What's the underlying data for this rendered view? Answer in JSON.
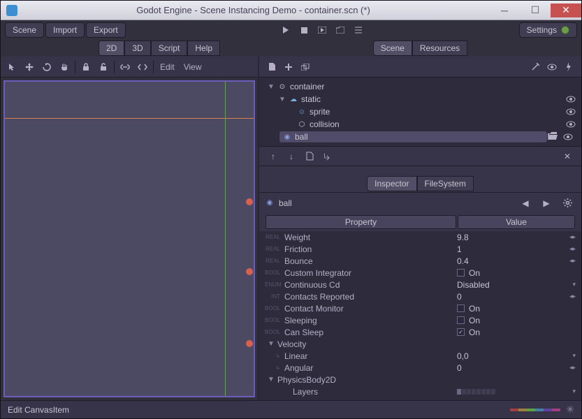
{
  "window": {
    "title": "Godot Engine - Scene Instancing Demo - container.scn (*)"
  },
  "menubar": {
    "scene": "Scene",
    "import": "Import",
    "export": "Export",
    "settings": "Settings"
  },
  "mode_tabs": {
    "d2": "2D",
    "d3": "3D",
    "script": "Script",
    "help": "Help"
  },
  "right_tabs": {
    "scene": "Scene",
    "resources": "Resources"
  },
  "viewport_toolbar": {
    "edit": "Edit",
    "view": "View"
  },
  "scene_tree": {
    "root": "container",
    "children": [
      {
        "name": "static",
        "icon": "cloud"
      },
      {
        "name": "sprite",
        "icon": "smiley",
        "indent": 1
      },
      {
        "name": "collision",
        "icon": "poly",
        "indent": 1
      },
      {
        "name": "ball",
        "icon": "ball",
        "selected": true
      }
    ]
  },
  "inspector_tabs": {
    "inspector": "Inspector",
    "filesystem": "FileSystem"
  },
  "inspector": {
    "object": "ball",
    "headers": {
      "property": "Property",
      "value": "Value"
    },
    "props": [
      {
        "type": "REAL",
        "name": "Weight",
        "value": "9.8",
        "widget": "spin"
      },
      {
        "type": "REAL",
        "name": "Friction",
        "value": "1",
        "widget": "spin"
      },
      {
        "type": "REAL",
        "name": "Bounce",
        "value": "0.4",
        "widget": "spin"
      },
      {
        "type": "BOOL",
        "name": "Custom Integrator",
        "value": "On",
        "widget": "check",
        "checked": false
      },
      {
        "type": "ENUM",
        "name": "Continuous Cd",
        "value": "Disabled",
        "widget": "drop"
      },
      {
        "type": "INT",
        "name": "Contacts Reported",
        "value": "0",
        "widget": "spin"
      },
      {
        "type": "BOOL",
        "name": "Contact Monitor",
        "value": "On",
        "widget": "check",
        "checked": false
      },
      {
        "type": "BOOL",
        "name": "Sleeping",
        "value": "On",
        "widget": "check",
        "checked": false
      },
      {
        "type": "BOOL",
        "name": "Can Sleep",
        "value": "On",
        "widget": "check",
        "checked": true
      }
    ],
    "groups": {
      "velocity": "Velocity",
      "linear": "Linear",
      "linear_val": "0,0",
      "angular": "Angular",
      "angular_val": "0",
      "physicsbody": "PhysicsBody2D",
      "layers": "Layers"
    }
  },
  "statusbar": {
    "text": "Edit CanvasItem"
  }
}
